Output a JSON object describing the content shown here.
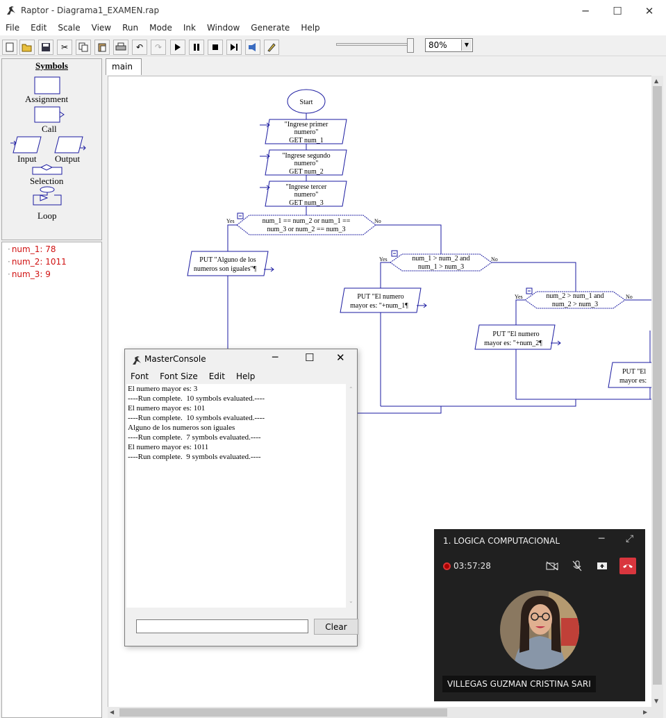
{
  "window": {
    "title": "Raptor - Diagrama1_EXAMEN.rap"
  },
  "menu": [
    "File",
    "Edit",
    "Scale",
    "View",
    "Run",
    "Mode",
    "Ink",
    "Window",
    "Generate",
    "Help"
  ],
  "toolbar": {
    "zoom_value": "80%"
  },
  "symbols": {
    "heading": "Symbols",
    "assignment": "Assignment",
    "call": "Call",
    "input": "Input",
    "output": "Output",
    "selection": "Selection",
    "loop": "Loop"
  },
  "variables": [
    "num_1: 78",
    "num_2: 1011",
    "num_3: 9"
  ],
  "tabs": [
    "main"
  ],
  "flowchart": {
    "start": "Start",
    "inputs": [
      {
        "prompt_1": "\"Ingrese primer",
        "prompt_2": "numero\"",
        "get": "GET num_1"
      },
      {
        "prompt_1": "\"Ingrese segundo",
        "prompt_2": "numero\"",
        "get": "GET num_2"
      },
      {
        "prompt_1": "\"Ingrese tercer",
        "prompt_2": "numero\"",
        "get": "GET num_3"
      }
    ],
    "decision1": {
      "line1": "num_1 == num_2 or num_1 ==",
      "line2": "num_3 or num_2 == num_3",
      "yes": "Yes",
      "no": "No"
    },
    "output1": {
      "line1": "PUT \"Alguno de los",
      "line2": "numeros son iguales\"¶"
    },
    "decision2": {
      "line1": "num_1 > num_2 and",
      "line2": "num_1 > num_3",
      "yes": "Yes",
      "no": "No"
    },
    "output2": {
      "line1": "PUT \"El numero",
      "line2": "mayor es: \"+num_1¶"
    },
    "decision3": {
      "line1": "num_2 > num_1 and",
      "line2": "num_2 > num_3",
      "yes": "Yes",
      "no": "No"
    },
    "output3": {
      "line1": "PUT \"El numero",
      "line2": "mayor es: \"+num_2¶"
    },
    "output4": {
      "line1": "PUT \"El",
      "line2": "mayor es:"
    }
  },
  "console": {
    "title": "MasterConsole",
    "menu": [
      "Font",
      "Font Size",
      "Edit",
      "Help"
    ],
    "lines": [
      "El numero mayor es: 3",
      "----Run complete.  10 symbols evaluated.----",
      "El numero mayor es: 101",
      "----Run complete.  10 symbols evaluated.----",
      "Alguno de los numeros son iguales",
      "----Run complete.  7 symbols evaluated.----",
      "El numero mayor es: 1011",
      "----Run complete.  9 symbols evaluated.----"
    ],
    "clear_label": "Clear"
  },
  "meeting": {
    "title": "1. LOGICA COMPUTACIONAL",
    "timer": "03:57:28",
    "participant": "VILLEGAS GUZMAN CRISTINA SARI"
  },
  "colors": {
    "flow_blue": "#1a1aa0",
    "variable_red": "#d01010",
    "hangup_red": "#d9363e"
  }
}
